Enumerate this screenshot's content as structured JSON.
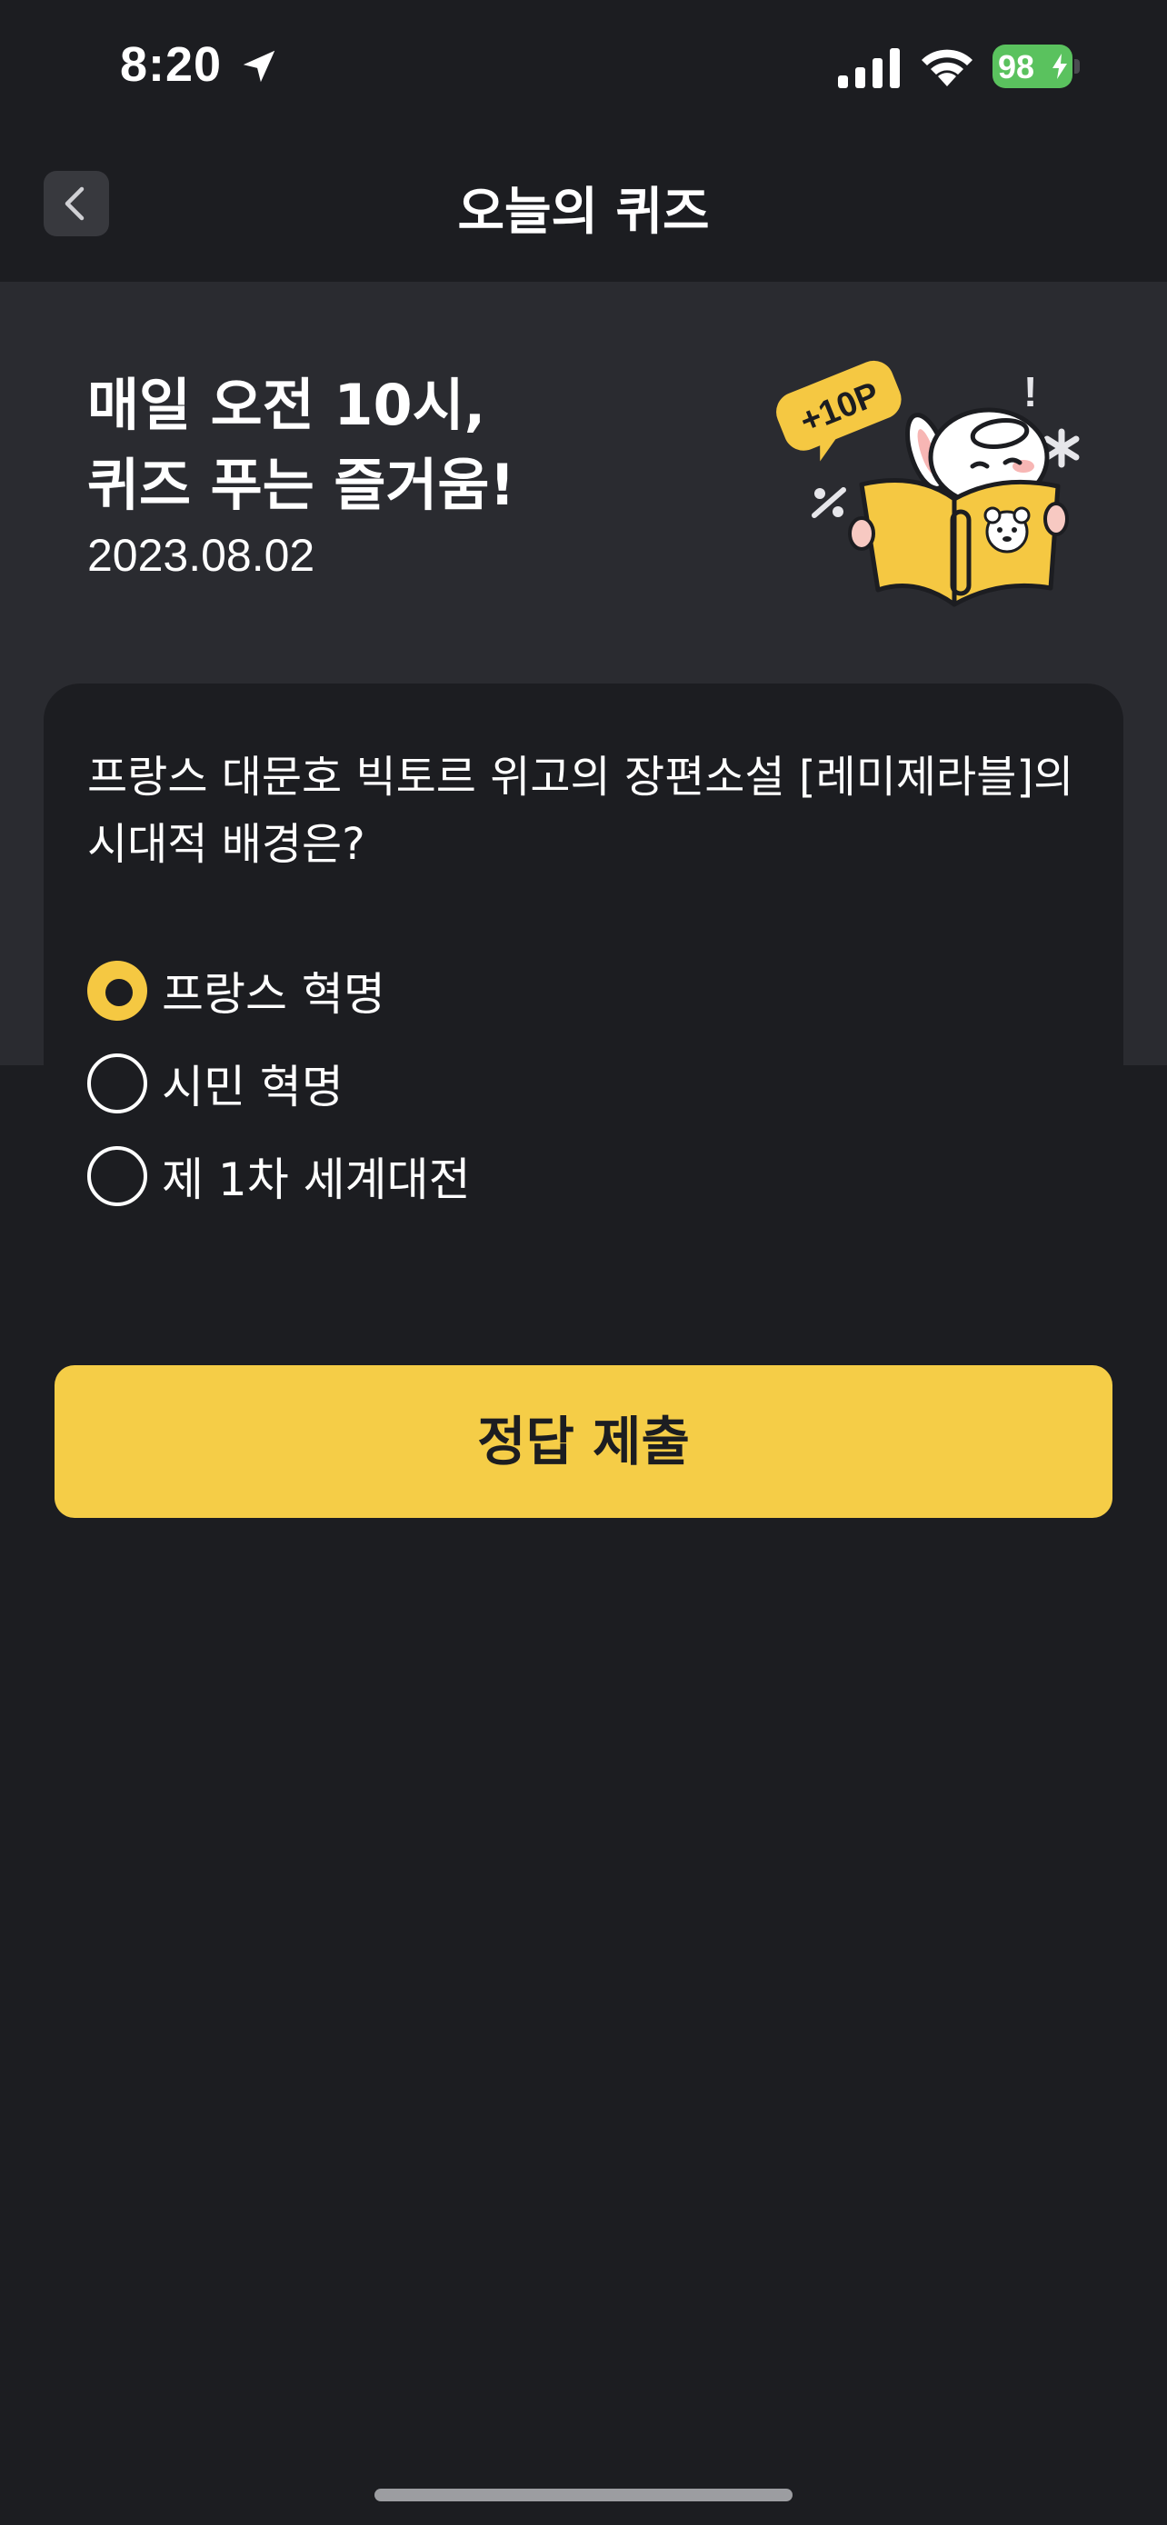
{
  "status_bar": {
    "time": "8:20",
    "battery": "98"
  },
  "nav": {
    "title": "오늘의 퀴즈"
  },
  "hero": {
    "title_line1": "매일 오전 10시,",
    "title_line2": "퀴즈 푸는 즐거움!",
    "date": "2023.08.02",
    "badge": "+10P"
  },
  "quiz": {
    "question": "프랑스 대문호 빅토르 위고의 장편소설 [레미제라블]의 시대적 배경은?",
    "options": [
      {
        "label": "프랑스 혁명",
        "selected": true
      },
      {
        "label": "시민 혁명",
        "selected": false
      },
      {
        "label": "제 1차 세계대전",
        "selected": false
      }
    ]
  },
  "submit": {
    "label": "정답 제출"
  },
  "colors": {
    "background": "#1c1d21",
    "hero_background": "#2a2b30",
    "accent": "#f5cd47",
    "battery": "#5ac25e"
  }
}
